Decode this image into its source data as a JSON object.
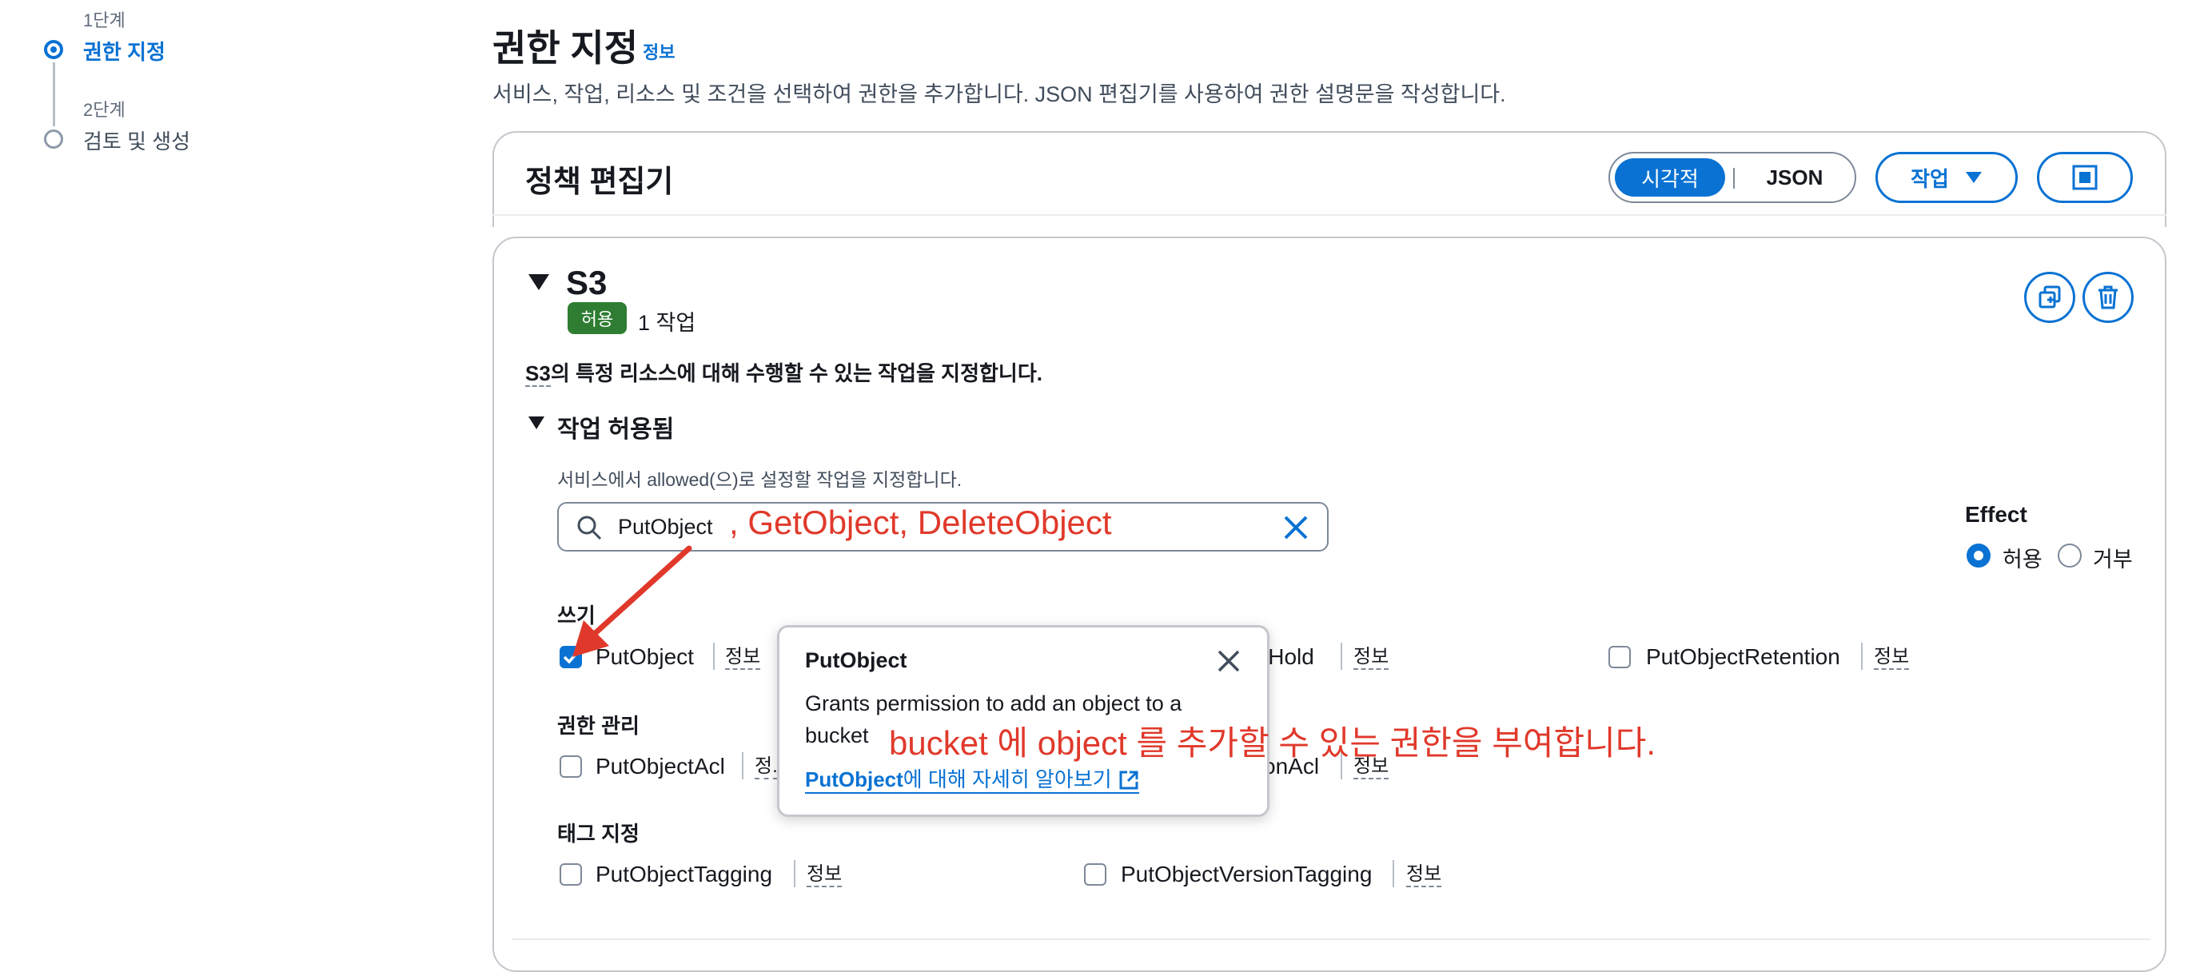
{
  "stepper": {
    "steps": [
      {
        "number": "1단계",
        "title": "권한 지정"
      },
      {
        "number": "2단계",
        "title": "검토 및 생성"
      }
    ]
  },
  "header": {
    "title": "권한 지정",
    "info": "정보",
    "description": "서비스, 작업, 리소스 및 조건을 선택하여 권한을 추가합니다. JSON 편집기를 사용하여 권한 설명문을 작성합니다."
  },
  "editor": {
    "title": "정책 편집기",
    "toggle_visual": "시각적",
    "toggle_json": "JSON",
    "actions_label": "작업"
  },
  "service": {
    "name": "S3",
    "badge": "허용",
    "action_count": "1 작업",
    "description_service": "S3",
    "description_rest": "의 특정 리소스에 대해 수행할 수 있는 작업을 지정합니다.",
    "section_title": "작업 허용됨",
    "section_hint": "서비스에서 allowed(으)로 설정할 작업을 지정합니다.",
    "search_value": "PutObject",
    "effect": {
      "title": "Effect",
      "options": [
        "허용",
        "거부"
      ],
      "selected": "허용"
    },
    "groups": {
      "write": {
        "title": "쓰기",
        "items": [
          {
            "label": "PutObject",
            "checked": true,
            "info": "정보"
          },
          {
            "label": "lHold",
            "checked": false,
            "info": "정보"
          },
          {
            "label": "PutObjectRetention",
            "checked": false,
            "info": "정보"
          }
        ]
      },
      "permissions": {
        "title": "권한 관리",
        "items": [
          {
            "label": "PutObjectAcl",
            "checked": false,
            "info": "정."
          },
          {
            "label": "onAcl",
            "checked": false,
            "info": "정보"
          }
        ]
      },
      "tagging": {
        "title": "태그 지정",
        "items": [
          {
            "label": "PutObjectTagging",
            "checked": false,
            "info": "정보"
          },
          {
            "label": "PutObjectVersionTagging",
            "checked": false,
            "info": "정보"
          }
        ]
      }
    }
  },
  "popover": {
    "title": "PutObject",
    "body_line1": "Grants permission to add an object to a",
    "body_line2": "bucket",
    "link_code": "PutObject",
    "link_text": "에 대해 자세히 알아보기"
  },
  "annotations": {
    "search_note": ", GetObject, DeleteObject",
    "popover_note": "bucket 에 object 를 추가할 수 있는 권한을 부여합니다.",
    "color": "#e0392b"
  },
  "colors": {
    "accent": "#0972d3",
    "badge_green": "#2e7d32"
  }
}
